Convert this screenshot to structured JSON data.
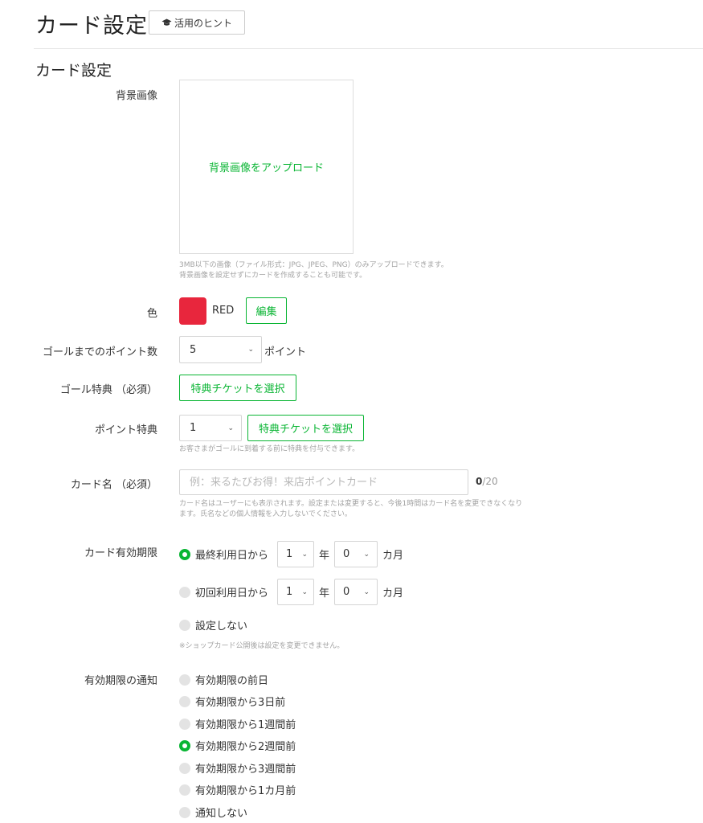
{
  "header": {
    "title": "カード設定",
    "hint_button": "活用のヒント"
  },
  "section": {
    "title": "カード設定"
  },
  "background": {
    "label": "背景画像",
    "upload_link": "背景画像をアップロード",
    "help_line1": "3MB以下の画像（ファイル形式：JPG、JPEG、PNG）のみアップロードできます。",
    "help_line2": "背景画像を設定せずにカードを作成することも可能です。"
  },
  "color": {
    "label": "色",
    "value": "RED",
    "swatch": "#e8263d",
    "edit_button": "編集"
  },
  "goal_points": {
    "label": "ゴールまでのポイント数",
    "value": "5",
    "suffix": "ポイント"
  },
  "goal_reward": {
    "label": "ゴール特典 （必須）",
    "button": "特典チケットを選択"
  },
  "point_reward": {
    "label": "ポイント特典",
    "value": "1",
    "button": "特典チケットを選択",
    "help": "お客さまがゴールに到着する前に特典を付与できます。"
  },
  "card_name": {
    "label": "カード名 （必須）",
    "placeholder": "例：来るたびお得！来店ポイントカード",
    "counter_current": "0",
    "counter_max": "/20",
    "help_line1": "カード名はユーザーにも表示されます。設定または変更すると、今後1時間はカード名を変更できなくなり",
    "help_line2": "ます。氏名などの個人情報を入力しないでください。"
  },
  "expiry": {
    "label": "カード有効期限",
    "options": [
      {
        "label": "最終利用日から",
        "selected": true,
        "years": "1",
        "year_unit": "年",
        "months": "0",
        "month_unit": "カ月"
      },
      {
        "label": "初回利用日から",
        "selected": false,
        "years": "1",
        "year_unit": "年",
        "months": "0",
        "month_unit": "カ月"
      },
      {
        "label": "設定しない",
        "selected": false
      }
    ],
    "note": "※ショップカード公開後は設定を変更できません。"
  },
  "notify": {
    "label": "有効期限の通知",
    "options": [
      {
        "label": "有効期限の前日",
        "selected": false
      },
      {
        "label": "有効期限から3日前",
        "selected": false
      },
      {
        "label": "有効期限から1週間前",
        "selected": false
      },
      {
        "label": "有効期限から2週間前",
        "selected": true
      },
      {
        "label": "有効期限から3週間前",
        "selected": false
      },
      {
        "label": "有効期限から1カ月前",
        "selected": false
      },
      {
        "label": "通知しない",
        "selected": false
      }
    ]
  },
  "colors": {
    "accent": "#09b533",
    "selected_color": "#e8263d"
  },
  "icons": {
    "hint": "graduation-cap-icon",
    "dropdown": "chevron-down-icon"
  }
}
